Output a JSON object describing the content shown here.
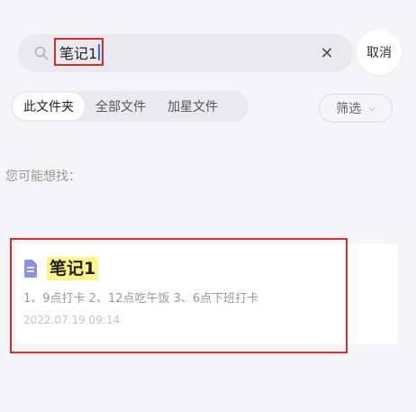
{
  "search": {
    "query": "笔记1",
    "clear_icon": "close-icon",
    "cancel_label": "取消"
  },
  "tabs": [
    {
      "label": "此文件夹",
      "active": true
    },
    {
      "label": "全部文件",
      "active": false
    },
    {
      "label": "加星文件",
      "active": false
    }
  ],
  "filter": {
    "label": "筛选",
    "icon": "chevron-down-icon"
  },
  "suggestions": {
    "label": "您可能想找：",
    "results": [
      {
        "icon": "document-icon",
        "title": "笔记1",
        "snippet": "1、9点打卡 2、12点吃午饭 3、6点下班打卡",
        "date": "2022.07.19 09:14"
      }
    ]
  },
  "colors": {
    "highlight": "#fff58a",
    "annotation_box": "#d32f2f",
    "doc_icon": "#8f8fe0"
  }
}
